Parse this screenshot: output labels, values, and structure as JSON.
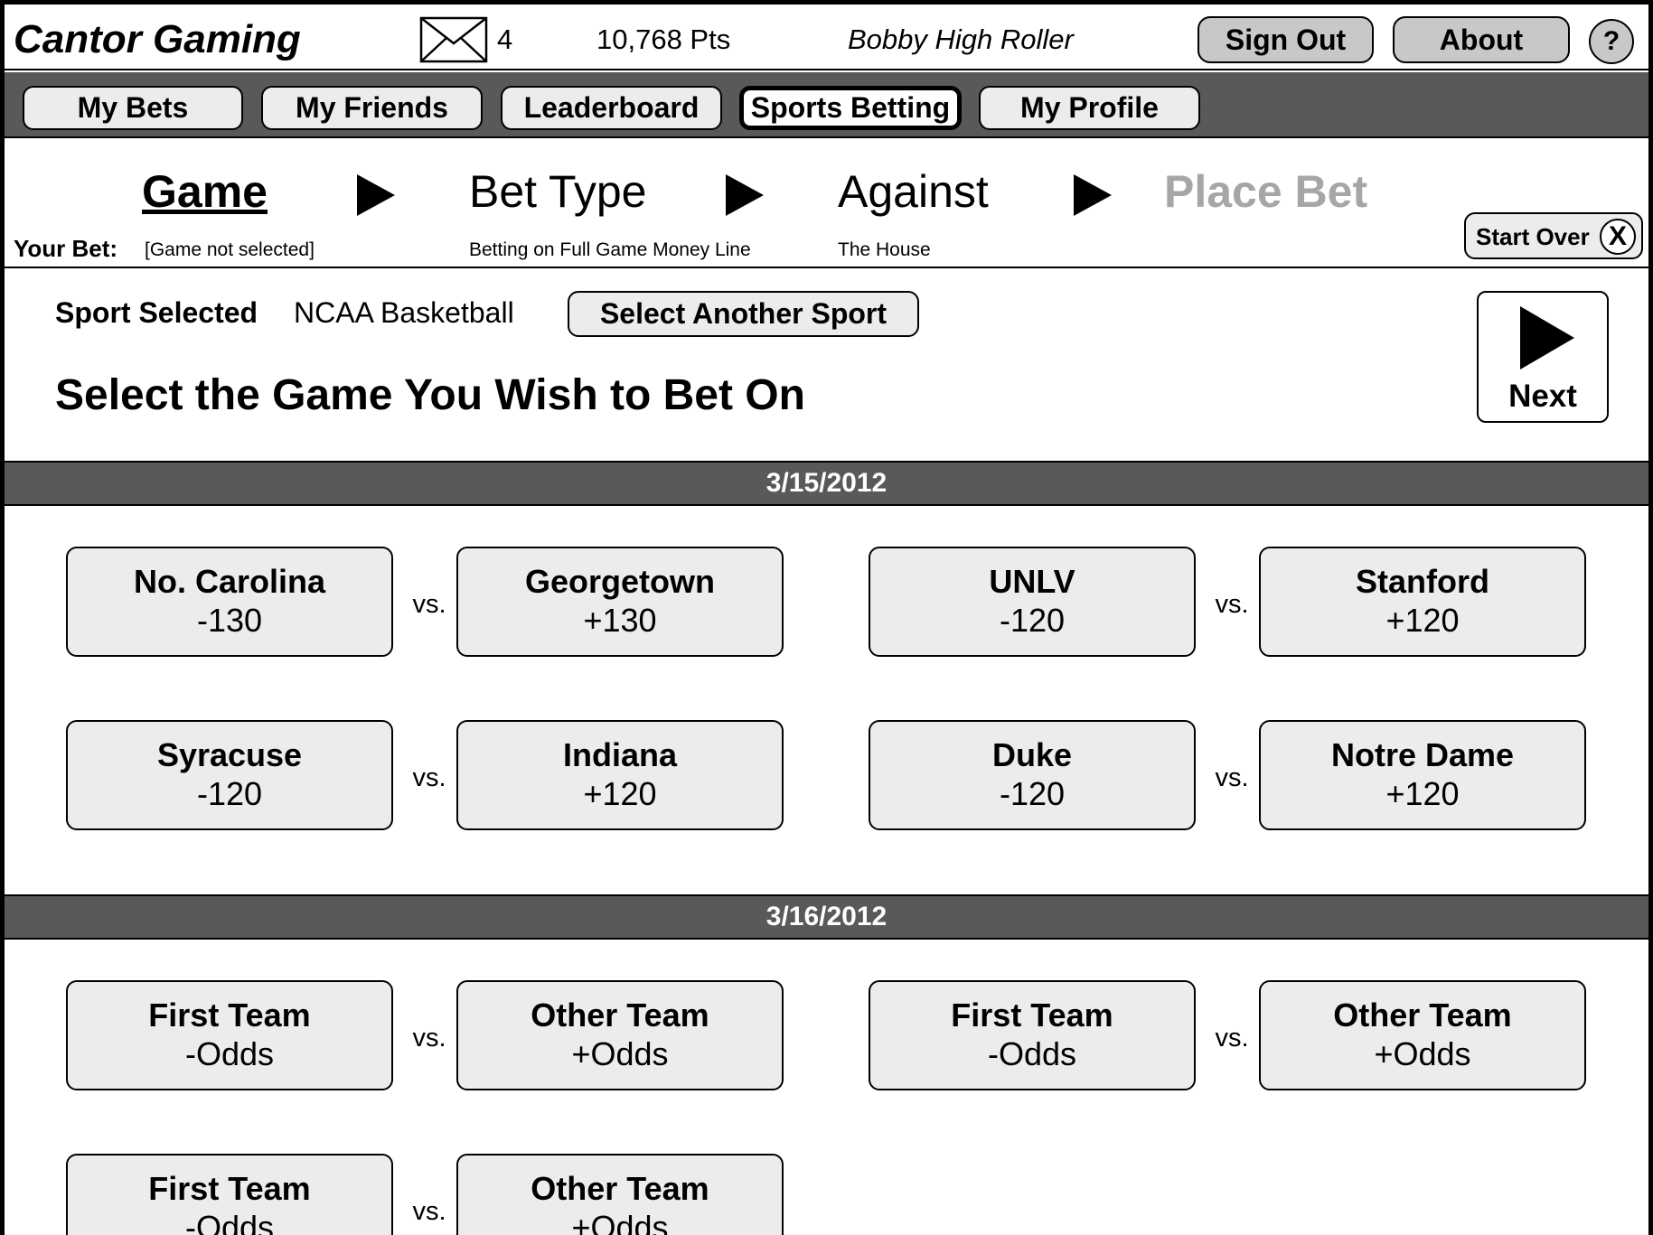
{
  "header": {
    "app_title": "Cantor Gaming",
    "mail_count": "4",
    "points": "10,768 Pts",
    "username": "Bobby High Roller",
    "sign_out_label": "Sign Out",
    "about_label": "About",
    "help_label": "?"
  },
  "nav": {
    "tabs": [
      {
        "label": "My Bets"
      },
      {
        "label": "My Friends"
      },
      {
        "label": "Leaderboard"
      },
      {
        "label": "Sports Betting",
        "active": true
      },
      {
        "label": "My Profile"
      }
    ]
  },
  "steps": {
    "items": [
      {
        "label": "Game",
        "state": "current",
        "detail": "[Game not selected]"
      },
      {
        "label": "Bet Type",
        "state": "upcoming",
        "detail": "Betting on Full Game Money Line"
      },
      {
        "label": "Against",
        "state": "upcoming",
        "detail": "The House"
      },
      {
        "label": "Place Bet",
        "state": "disabled"
      }
    ],
    "your_bet_label": "Your Bet:",
    "start_over_label": "Start Over",
    "start_over_icon": "X"
  },
  "sport": {
    "label": "Sport Selected",
    "value": "NCAA Basketball",
    "select_another_label": "Select Another Sport"
  },
  "main": {
    "heading": "Select the Game You Wish to Bet On",
    "next_label": "Next"
  },
  "vs_label": "vs.",
  "days": [
    {
      "date": "3/15/2012",
      "games": [
        {
          "home": {
            "name": "No. Carolina",
            "odds": "-130"
          },
          "away": {
            "name": "Georgetown",
            "odds": "+130"
          }
        },
        {
          "home": {
            "name": "UNLV",
            "odds": "-120"
          },
          "away": {
            "name": "Stanford",
            "odds": "+120"
          }
        },
        {
          "home": {
            "name": "Syracuse",
            "odds": "-120"
          },
          "away": {
            "name": "Indiana",
            "odds": "+120"
          }
        },
        {
          "home": {
            "name": "Duke",
            "odds": "-120"
          },
          "away": {
            "name": "Notre Dame",
            "odds": "+120"
          }
        }
      ]
    },
    {
      "date": "3/16/2012",
      "games": [
        {
          "home": {
            "name": "First Team",
            "odds": "-Odds"
          },
          "away": {
            "name": "Other Team",
            "odds": "+Odds"
          }
        },
        {
          "home": {
            "name": "First Team",
            "odds": "-Odds"
          },
          "away": {
            "name": "Other Team",
            "odds": "+Odds"
          }
        },
        {
          "home": {
            "name": "First Team",
            "odds": "-Odds"
          },
          "away": {
            "name": "Other Team",
            "odds": "+Odds"
          }
        }
      ]
    }
  ]
}
